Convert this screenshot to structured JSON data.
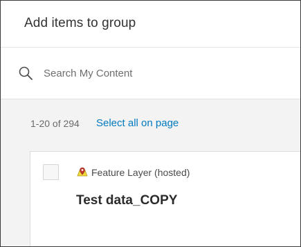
{
  "dialog": {
    "title": "Add items to group"
  },
  "search": {
    "placeholder": "Search My Content",
    "value": "",
    "icon": "search-icon"
  },
  "results": {
    "count_text": "1-20 of 294",
    "select_all_label": "Select all on page"
  },
  "items": [
    {
      "type_label": "Feature Layer (hosted)",
      "type_icon": "feature-layer-icon",
      "title": "Test data_COPY",
      "checked": false
    }
  ],
  "colors": {
    "link": "#0079c1",
    "layer_icon_fill": "#f2d83b",
    "layer_icon_marker": "#c0392b"
  }
}
